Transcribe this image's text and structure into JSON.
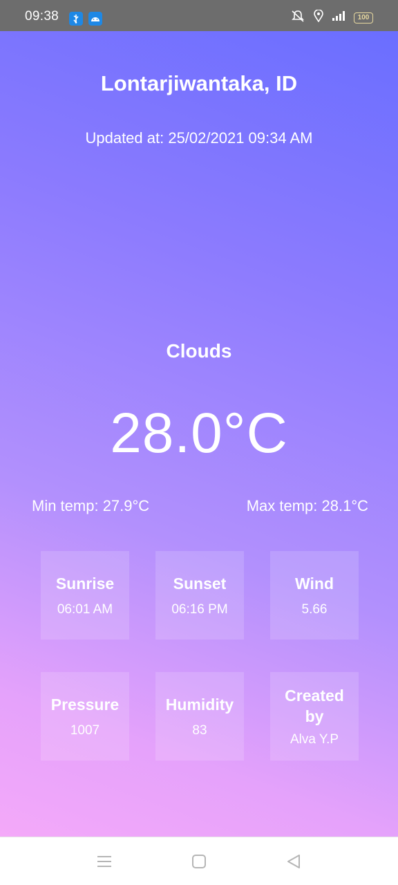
{
  "status_bar": {
    "time": "09:38",
    "battery": "100",
    "left_icons": [
      "usb-icon",
      "android-icon"
    ],
    "right_icons": [
      "mute-icon",
      "location-icon",
      "signal-icon",
      "battery-icon"
    ]
  },
  "weather": {
    "location": "Lontarjiwantaka, ID",
    "updated_at": "Updated at: 25/02/2021 09:34 AM",
    "condition": "Clouds",
    "temperature": "28.0°C",
    "min_temp": "Min temp: 27.9°C",
    "max_temp": "Max temp: 28.1°C"
  },
  "cards": [
    {
      "title": "Sunrise",
      "value": "06:01 AM"
    },
    {
      "title": "Sunset",
      "value": "06:16 PM"
    },
    {
      "title": "Wind",
      "value": "5.66"
    },
    {
      "title": "Pressure",
      "value": "1007"
    },
    {
      "title": "Humidity",
      "value": "83"
    },
    {
      "title": "Created by",
      "value": "Alva Y.P"
    }
  ],
  "nav_bar": {
    "icons": [
      "menu-icon",
      "home-icon",
      "back-icon"
    ]
  },
  "colors": {
    "gradient_top": "#6a6eff",
    "gradient_bottom": "#f4a9f9",
    "status_bar": "#6d6d6d"
  }
}
